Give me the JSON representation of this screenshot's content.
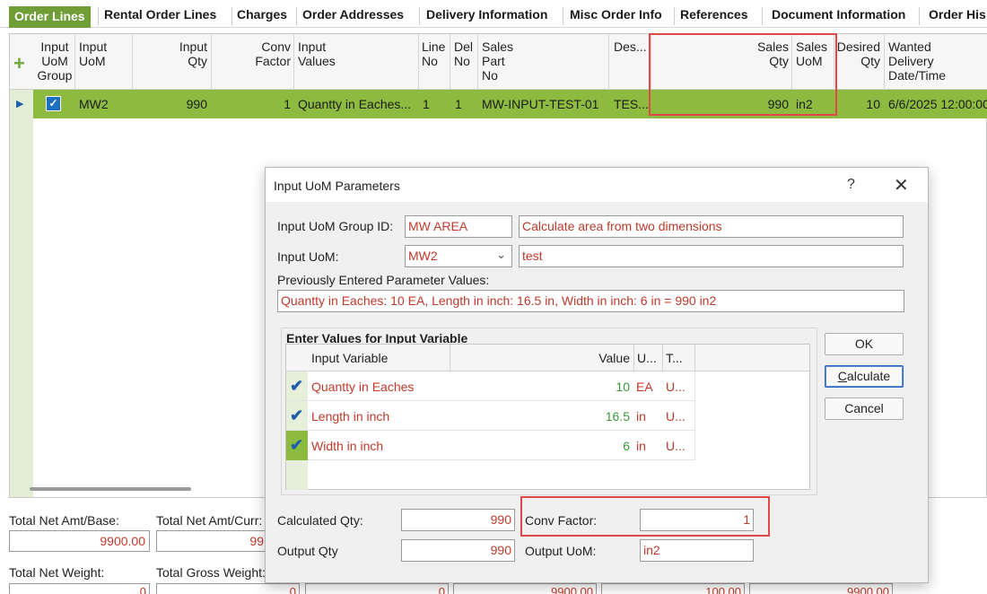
{
  "tabs": [
    "Order Lines",
    "Rental Order Lines",
    "Charges",
    "Order Addresses",
    "Delivery Information",
    "Misc Order Info",
    "References",
    "Document Information",
    "Order His"
  ],
  "grid": {
    "headers": {
      "input_uom_group": "Input\nUoM\nGroup",
      "input_uom": "Input\nUoM",
      "input_qty": "Input\nQty",
      "conv_factor": "Conv\nFactor",
      "input_values": "Input\nValues",
      "line_no": "Line\nNo",
      "del_no": "Del\nNo",
      "sales_part_no": "Sales\nPart\nNo",
      "description": "Des...",
      "sales_qty": "Sales\nQty",
      "sales_uom": "Sales\nUoM",
      "desired_qty": "Desired\nQty",
      "wanted_delivery": "Wanted\nDelivery\nDate/Time"
    },
    "row": {
      "input_uom": "MW2",
      "input_qty": "990",
      "conv_factor": "1",
      "input_values": "Quantty in Eaches...",
      "line_no": "1",
      "del_no": "1",
      "sales_part_no": "MW-INPUT-TEST-01",
      "description": "TES...",
      "sales_qty": "990",
      "sales_uom": "in2",
      "desired_qty": "10",
      "wanted_delivery": "6/6/2025 12:00:00"
    }
  },
  "totals": {
    "net_amt_base_label": "Total Net Amt/Base:",
    "net_amt_base": "9900.00",
    "net_amt_curr_label": "Total Net Amt/Curr:",
    "net_amt_curr": "99",
    "net_weight_label": "Total Net Weight:",
    "net_weight": "0",
    "gross_weight_label": "Total Gross Weight:",
    "gross_weight": "0",
    "bottom_values": [
      "0",
      "9900.00",
      "100.00",
      "9900.00"
    ]
  },
  "dialog": {
    "title": "Input UoM Parameters",
    "help": "?",
    "close": "✕",
    "group_id_label": "Input UoM Group ID:",
    "group_id": "MW AREA",
    "group_desc": "Calculate area from two dimensions",
    "input_uom_label": "Input UoM:",
    "input_uom": "MW2",
    "input_uom_desc": "test",
    "prev_label": "Previously Entered Parameter Values:",
    "prev_values": "Quantty in Eaches: 10 EA, Length in inch: 16.5 in, Width in inch: 6 in = 990 in2",
    "enter_values_title": "Enter Values for Input Variable",
    "table_headers": {
      "variable": "Input Variable",
      "value": "Value",
      "uom": "U...",
      "type": "T..."
    },
    "rows": [
      {
        "variable": "Quantty in Eaches",
        "value": "10",
        "uom": "EA",
        "type": "U..."
      },
      {
        "variable": "Length in inch",
        "value": "16.5",
        "uom": "in",
        "type": "U..."
      },
      {
        "variable": "Width in inch",
        "value": "6",
        "uom": "in",
        "type": "U..."
      }
    ],
    "ok": "OK",
    "calculate_pre": "",
    "calculate_underline": "C",
    "calculate_post": "alculate",
    "cancel": "Cancel",
    "calc_qty_label": "Calculated Qty:",
    "calc_qty": "990",
    "conv_factor_label": "Conv Factor:",
    "conv_factor": "1",
    "output_qty_label": "Output Qty",
    "output_qty": "990",
    "output_uom_label": "Output UoM:",
    "output_uom": "in2"
  }
}
